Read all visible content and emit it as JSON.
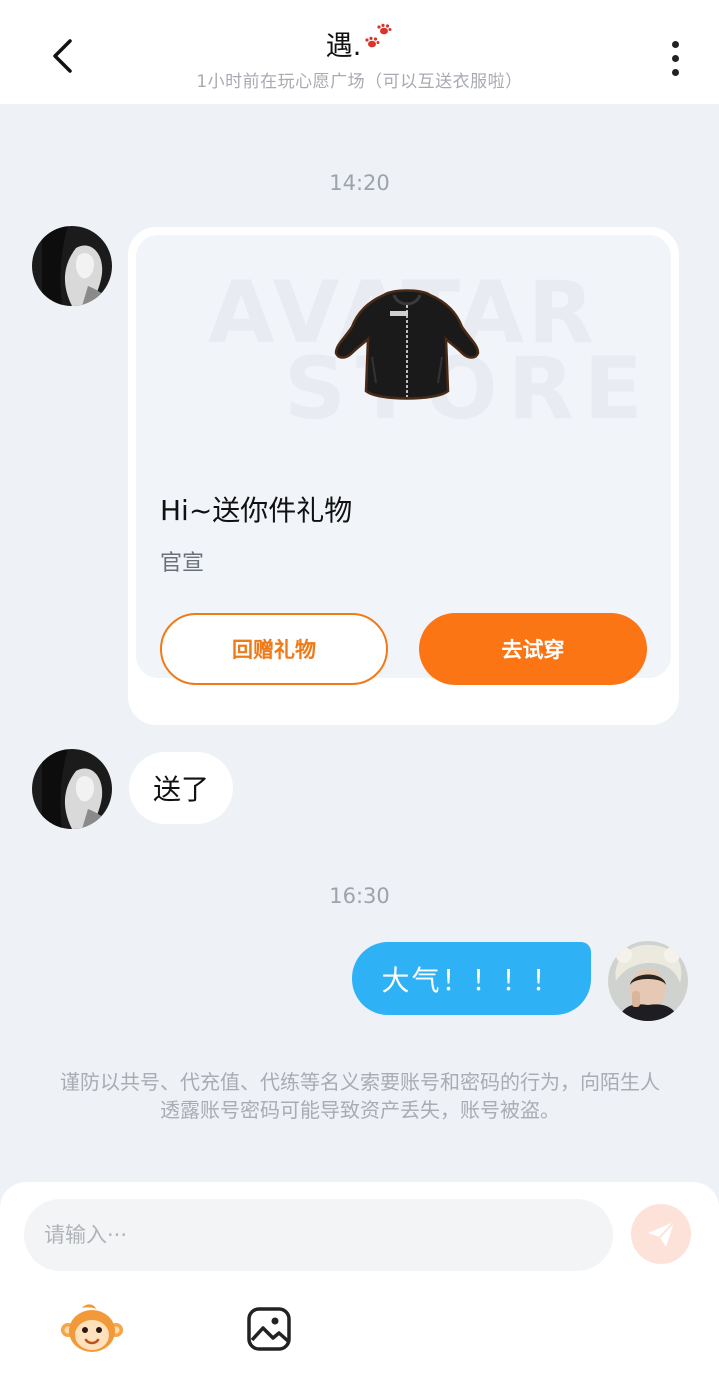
{
  "header": {
    "title": "遇.",
    "subtitle": "1小时前在玩心愿广场（可以互送衣服啦）",
    "back_icon": "chevron-left-icon",
    "more_icon": "more-vertical-icon",
    "title_decoration_icon": "paw-prints-icon"
  },
  "messages": {
    "timestamp_1": "14:20",
    "gift_card": {
      "image_watermark_line1": "AVATAR",
      "image_watermark_line2": "STORE",
      "title": "Hi~送你件礼物",
      "subtitle": "官宣",
      "return_gift_label": "回赠礼物",
      "try_on_label": "去试穿"
    },
    "bubble_left_text": "送了",
    "timestamp_2": "16:30",
    "bubble_right_text": "大气！！！！",
    "notice": "谨防以共号、代充值、代练等名义索要账号和密码的行为，向陌生人透露账号密码可能导致资产丢失，账号被盗。"
  },
  "composer": {
    "placeholder": "请输入···",
    "send_icon": "paper-plane-icon",
    "emoji_icon": "monkey-emoji-icon",
    "image_icon": "image-icon"
  },
  "colors": {
    "accent_orange": "#fb7514",
    "bubble_blue": "#2eb2f5",
    "background": "#eef1f5"
  }
}
